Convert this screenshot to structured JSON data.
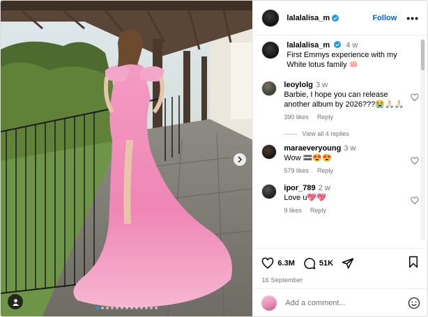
{
  "post": {
    "username": "lalalalisa_m",
    "follow_label": "Follow",
    "more_label": "•••"
  },
  "caption": {
    "username": "lalalalisa_m",
    "time": "4 w",
    "text_line1": "First Emmys experience with my",
    "text_line2": "White lotus family 🪷"
  },
  "comments": [
    {
      "username": "leoylolg",
      "time": "3 w",
      "text": "Barbie, I hope you can release another album by 2026???😭🙏🏻🙏🏻",
      "likes": "390 likes",
      "reply": "Reply"
    },
    {
      "username": "maraeveryoung",
      "time": "3 w",
      "text": "Wow 🟰😍😍",
      "likes": "579 likes",
      "reply": "Reply"
    },
    {
      "username": "ipor_789",
      "time": "2 w",
      "text": "Love u💖💖",
      "likes": "9 likes",
      "reply": "Reply"
    }
  ],
  "view_replies": "View all 4 replies",
  "stats": {
    "likes": "6.3M",
    "comments": "51K",
    "date": "16 September"
  },
  "composer": {
    "placeholder": "Add a comment..."
  },
  "carousel": {
    "count": 13,
    "active_index": 0
  },
  "icons": {
    "verified": "verified-badge-icon",
    "like": "heart-icon",
    "comment": "comment-icon",
    "share": "share-icon",
    "save": "bookmark-icon",
    "emoji": "emoji-icon",
    "next": "chevron-right-icon",
    "tag": "user-tag-icon"
  },
  "colors": {
    "accent": "#0064e0",
    "verified": "#1d9bf0",
    "muted": "#737373"
  }
}
